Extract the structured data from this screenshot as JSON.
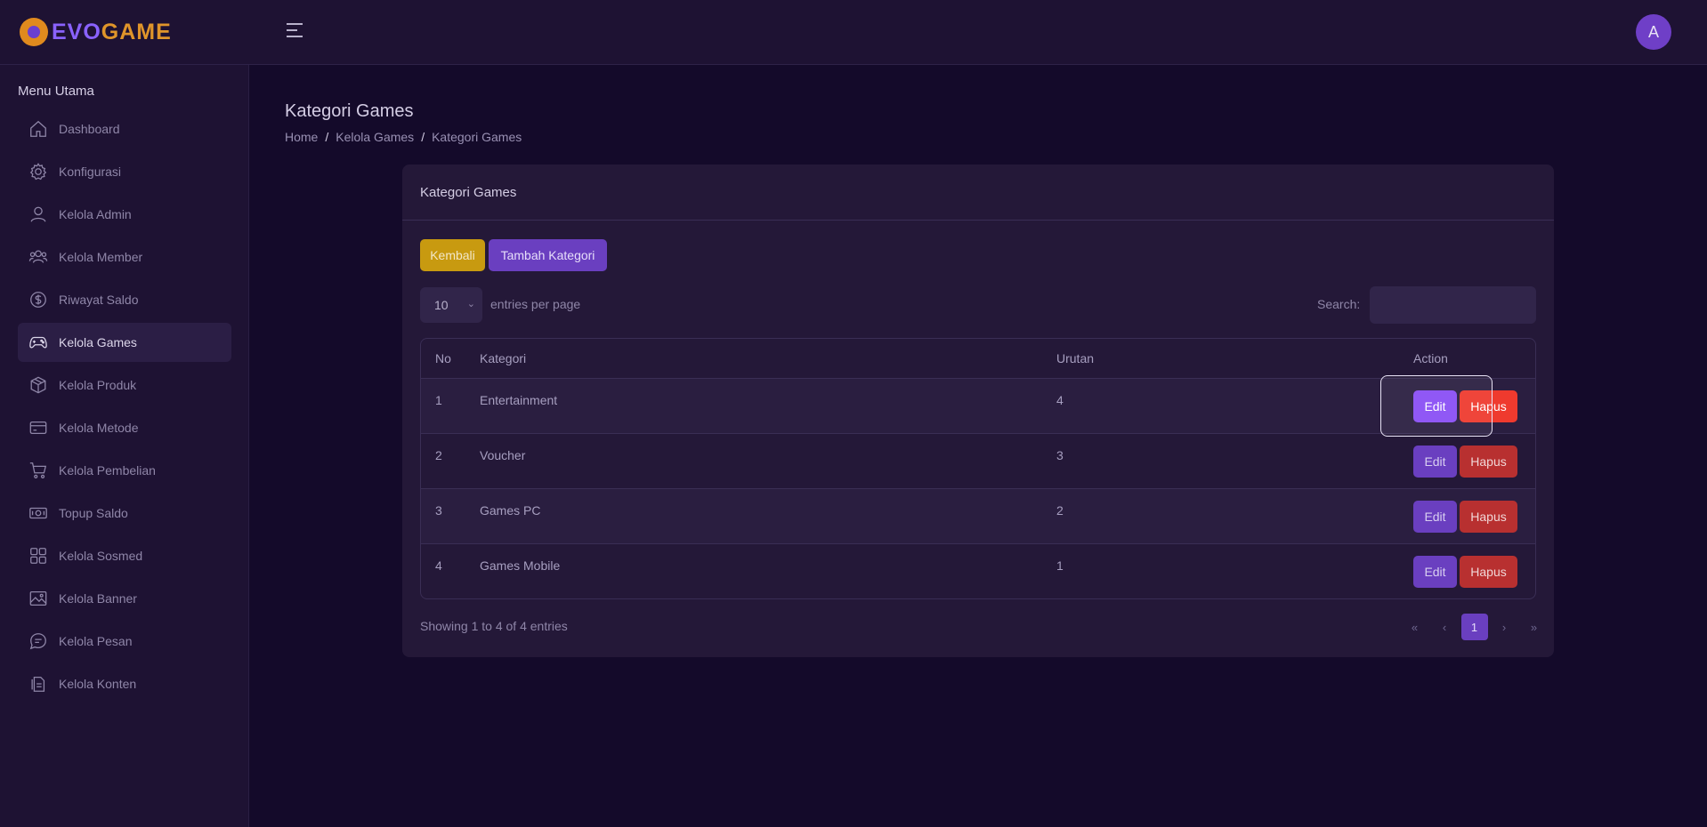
{
  "brand": {
    "logo_text_a": "EVO",
    "logo_text_b": "GAME",
    "accent": "#8a62ff",
    "logo_color": "#e0952a"
  },
  "topbar": {
    "menu_icon": "hamburger-icon",
    "avatar_initial": "A"
  },
  "sidebar": {
    "title": "Menu Utama",
    "items": [
      {
        "label": "Dashboard",
        "icon": "home-icon"
      },
      {
        "label": "Konfigurasi",
        "icon": "gear-icon"
      },
      {
        "label": "Kelola Admin",
        "icon": "user-icon"
      },
      {
        "label": "Kelola Member",
        "icon": "users-icon"
      },
      {
        "label": "Riwayat Saldo",
        "icon": "dollar-circle-icon"
      },
      {
        "label": "Kelola Games",
        "icon": "gamepad-icon",
        "active": true
      },
      {
        "label": "Kelola Produk",
        "icon": "box-icon"
      },
      {
        "label": "Kelola Metode",
        "icon": "credit-card-icon"
      },
      {
        "label": "Kelola Pembelian",
        "icon": "cart-icon"
      },
      {
        "label": "Topup Saldo",
        "icon": "money-icon"
      },
      {
        "label": "Kelola Sosmed",
        "icon": "grid-icon"
      },
      {
        "label": "Kelola Banner",
        "icon": "image-icon"
      },
      {
        "label": "Kelola Pesan",
        "icon": "chat-icon"
      },
      {
        "label": "Kelola Konten",
        "icon": "document-icon"
      }
    ]
  },
  "page": {
    "title": "Kategori Games",
    "breadcrumb": [
      "Home",
      "Kelola Games",
      "Kategori Games"
    ],
    "breadcrumb_sep": "/"
  },
  "card": {
    "title": "Kategori Games",
    "back_label": "Kembali",
    "add_label": "Tambah Kategori",
    "entries_value": "10",
    "entries_label": "entries per page",
    "search_label": "Search:",
    "search_value": "",
    "columns": [
      "No",
      "Kategori",
      "Urutan",
      "Action"
    ],
    "rows": [
      {
        "no": "1",
        "kategori": "Entertainment",
        "urutan": "4"
      },
      {
        "no": "2",
        "kategori": "Voucher",
        "urutan": "3"
      },
      {
        "no": "3",
        "kategori": "Games PC",
        "urutan": "2"
      },
      {
        "no": "4",
        "kategori": "Games Mobile",
        "urutan": "1"
      }
    ],
    "edit_label": "Edit",
    "delete_label": "Hapus",
    "info": "Showing 1 to 4 of 4 entries",
    "pager": {
      "first": "«",
      "prev": "‹",
      "current": "1",
      "next": "›",
      "last": "»"
    }
  }
}
